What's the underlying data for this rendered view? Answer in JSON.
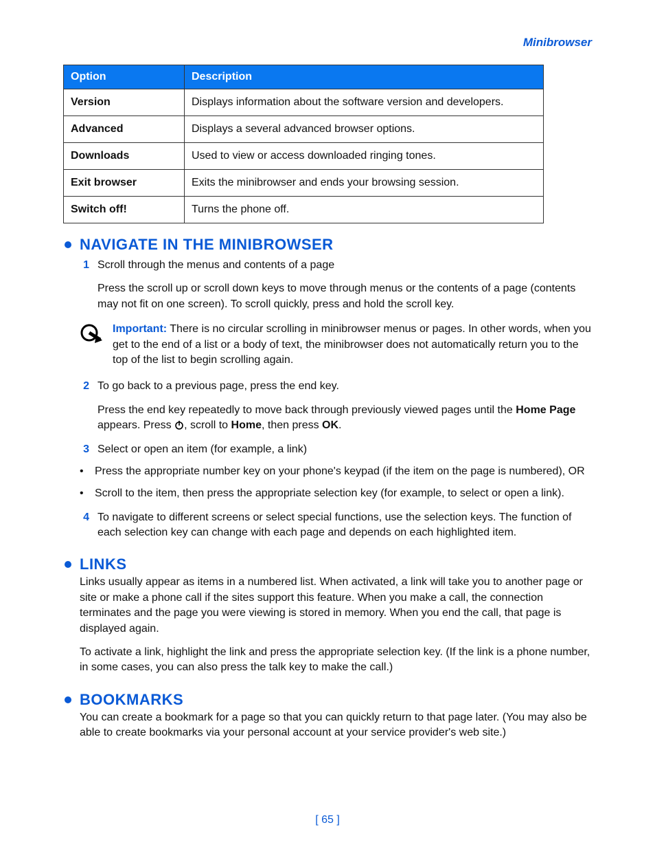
{
  "running_head": "Minibrowser",
  "table": {
    "headers": {
      "option": "Option",
      "description": "Description"
    },
    "rows": [
      {
        "option": "Version",
        "description": "Displays information about the software version and developers."
      },
      {
        "option": "Advanced",
        "description": "Displays a several advanced browser options."
      },
      {
        "option": "Downloads",
        "description": "Used to view or access downloaded ringing tones."
      },
      {
        "option": "Exit browser",
        "description": "Exits the minibrowser and ends your browsing session."
      },
      {
        "option": "Switch off!",
        "description": "Turns the phone off."
      }
    ]
  },
  "sections": {
    "navigate": {
      "title": "NAVIGATE IN THE MINIBROWSER",
      "items": {
        "s1": {
          "num": "1",
          "lead": "Scroll through the menus and contents of a page",
          "para": "Press the scroll up or scroll down keys to move through menus or the contents of a page (contents may not fit on one screen). To scroll quickly, press and hold the scroll key."
        },
        "note": {
          "label": "Important:",
          "text": " There is no circular scrolling in minibrowser menus or pages. In other words, when you get to the end of a list or a body of text, the minibrowser does not automatically return you to the top of the list to begin scrolling again."
        },
        "s2": {
          "num": "2",
          "lead": "To go back to a previous page, press the end key.",
          "para_pre": "Press the end key repeatedly to move back through previously viewed pages until the ",
          "home_page": "Home Page",
          "para_mid": " appears. Press ",
          "scroll_to": ", scroll to ",
          "home": "Home",
          "then_press": ", then press ",
          "ok": "OK",
          "period": "."
        },
        "s3": {
          "num": "3",
          "lead": "Select or open an item (for example, a link)",
          "b1": "Press the appropriate number key on your phone's keypad (if the item on the page is numbered), OR",
          "b2": "Scroll to the item, then press the appropriate selection key (for example, to select or open a link)."
        },
        "s4": {
          "num": "4",
          "lead": "To navigate to different screens or select special functions, use the selection keys. The function of each selection key can change with each page and depends on each highlighted item."
        }
      }
    },
    "links": {
      "title": "LINKS",
      "p1": "Links usually appear as items in a numbered list. When activated, a link will take you to another page or site or make a phone call if the sites support this feature. When you make a call, the connection terminates and the page you were viewing is stored in memory. When you end the call, that page is displayed again.",
      "p2": "To activate a link, highlight the link and press the appropriate selection key. (If the link is a phone number, in some cases, you can also press the talk key to make the call.)"
    },
    "bookmarks": {
      "title": "BOOKMARKS",
      "p1": "You can create a bookmark for a page so that you can quickly return to that page later. (You may also be able to create bookmarks via your personal account at your service provider's web site.)"
    }
  },
  "footer": {
    "page": "[ 65 ]"
  }
}
